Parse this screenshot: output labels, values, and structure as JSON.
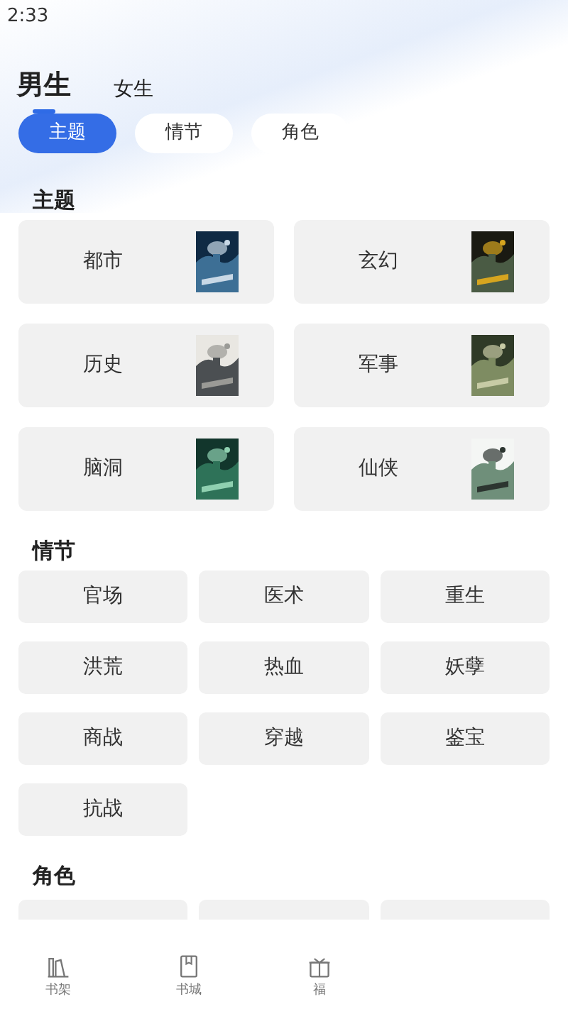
{
  "status_bar": {
    "time": "2:33"
  },
  "gender_tabs": [
    {
      "label": "男生",
      "selected": true
    },
    {
      "label": "女生",
      "selected": false
    }
  ],
  "category_pills": [
    {
      "label": "主题",
      "selected": true
    },
    {
      "label": "情节",
      "selected": false
    },
    {
      "label": "角色",
      "selected": false
    }
  ],
  "sections": [
    {
      "title": "主题",
      "kind": "theme",
      "items": [
        {
          "label": "都市"
        },
        {
          "label": "玄幻"
        },
        {
          "label": "历史"
        },
        {
          "label": "军事"
        },
        {
          "label": "脑洞"
        },
        {
          "label": "仙侠"
        }
      ]
    },
    {
      "title": "情节",
      "kind": "plot",
      "items": [
        {
          "label": "官场"
        },
        {
          "label": "医术"
        },
        {
          "label": "重生"
        },
        {
          "label": "洪荒"
        },
        {
          "label": "热血"
        },
        {
          "label": "妖孽"
        },
        {
          "label": "商战"
        },
        {
          "label": "穿越"
        },
        {
          "label": "鉴宝"
        },
        {
          "label": "抗战"
        }
      ]
    },
    {
      "title": "角色",
      "kind": "role"
    }
  ],
  "bottom_nav": [
    {
      "label": "书架"
    },
    {
      "label": "书城"
    },
    {
      "label": "福"
    }
  ]
}
